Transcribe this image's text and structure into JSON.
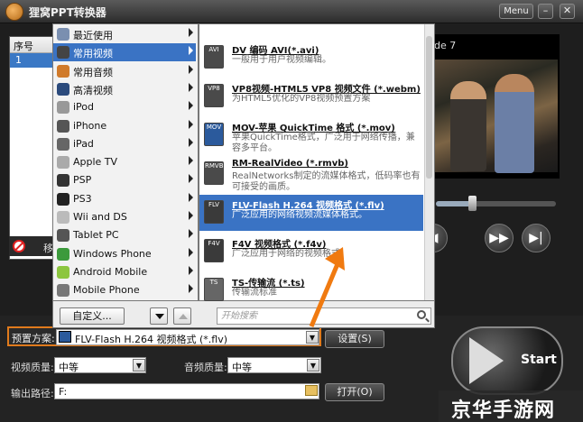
{
  "app": {
    "title": "狸窝PPT转换器",
    "menu_label": "Menu",
    "min_label": "–",
    "close_label": "✕"
  },
  "file_list": {
    "col_index": "序号",
    "rows": [
      {
        "index": "1"
      }
    ],
    "remove_label": "移"
  },
  "preview": {
    "label": "de 7",
    "progress": 0.3
  },
  "menu": {
    "categories": [
      {
        "label": "最近使用",
        "icon": "clock-icon",
        "color": "#7a8fb0"
      },
      {
        "label": "常用视频",
        "icon": "film-icon",
        "color": "#444",
        "selected": true
      },
      {
        "label": "常用音频",
        "icon": "music-icon",
        "color": "#d07a2a"
      },
      {
        "label": "高清视频",
        "icon": "hd-icon",
        "color": "#2b4a7c"
      },
      {
        "label": "iPod",
        "icon": "ipod-icon",
        "color": "#999"
      },
      {
        "label": "iPhone",
        "icon": "iphone-icon",
        "color": "#555"
      },
      {
        "label": "iPad",
        "icon": "ipad-icon",
        "color": "#666"
      },
      {
        "label": "Apple TV",
        "icon": "apple-icon",
        "color": "#aaa"
      },
      {
        "label": "PSP",
        "icon": "psp-icon",
        "color": "#333"
      },
      {
        "label": "PS3",
        "icon": "ps3-icon",
        "color": "#222"
      },
      {
        "label": "Wii and DS",
        "icon": "wii-icon",
        "color": "#bbb"
      },
      {
        "label": "Tablet PC",
        "icon": "tablet-icon",
        "color": "#555"
      },
      {
        "label": "Windows Phone",
        "icon": "windows-icon",
        "color": "#3c9a3c"
      },
      {
        "label": "Android Mobile",
        "icon": "android-icon",
        "color": "#8cc63f"
      },
      {
        "label": "Mobile Phone",
        "icon": "phone-icon",
        "color": "#777"
      }
    ],
    "formats": [
      {
        "title": "DV 编码 AVI(*.avi)",
        "desc": "一般用于用户视频编辑。",
        "icon_text": "AVI",
        "color": "#4a4a4a"
      },
      {
        "title": "VP8视频-HTML5 VP8 视频文件 (*.webm)",
        "desc": "为HTML5优化的VP8视频预置方案",
        "icon_text": "VP8",
        "color": "#4a4a4a"
      },
      {
        "title": "MOV-苹果 QuickTime 格式 (*.mov)",
        "desc": "苹果QuickTime格式，广泛用于网络传播，兼容多平台。",
        "icon_text": "MOV",
        "color": "#2b5a9c"
      },
      {
        "title": "RM-RealVideo (*.rmvb)",
        "desc": "RealNetworks制定的流媒体格式，低码率也有可接受的画质。",
        "icon_text": "RMVB",
        "color": "#4a4a4a"
      },
      {
        "title": "FLV-Flash H.264 视频格式 (*.flv)",
        "desc": "广泛应用的网络视频流媒体格式。",
        "icon_text": "FLV",
        "color": "#3a3a3a",
        "selected": true
      },
      {
        "title": "F4V 视频格式 (*.f4v)",
        "desc": "广泛应用于网络的视频格式。",
        "icon_text": "F4V",
        "color": "#3a3a3a"
      },
      {
        "title": "TS-传输流 (*.ts)",
        "desc": "传输流标准",
        "icon_text": "TS",
        "color": "#666"
      }
    ],
    "custom_label": "自定义...",
    "search_placeholder": "开始搜索"
  },
  "settings": {
    "preset_label": "预置方案:",
    "preset_value": "FLV-Flash H.264 视频格式 (*.flv)",
    "settings_btn": "设置(S)",
    "video_quality_label": "视频质量:",
    "video_quality_value": "中等",
    "audio_quality_label": "音频质量:",
    "audio_quality_value": "中等",
    "output_label": "输出路径:",
    "output_value": "F:",
    "open_btn": "打开(O)",
    "start_label": "Start"
  },
  "watermark": "京华手游网"
}
